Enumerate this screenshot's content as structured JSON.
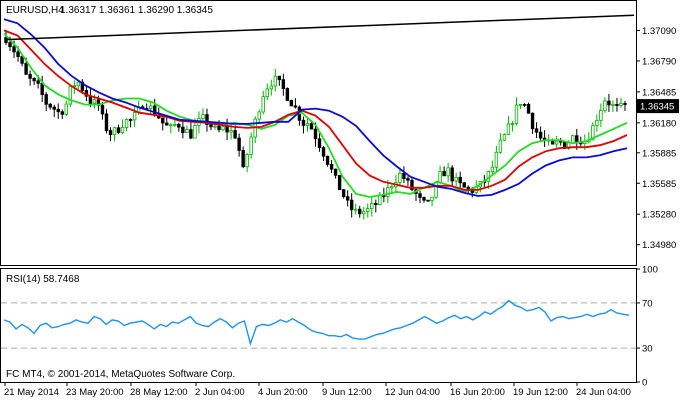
{
  "header": {
    "symbol_label": "EURUSD,H4",
    "ohlc": "1.36317 1.36361 1.36290 1.36345"
  },
  "indicator": {
    "label": "RSI(14) 58.7468"
  },
  "footer": {
    "copyright": "FC MT4, © 2001-2014, MetaQuotes Software Corp."
  },
  "colors": {
    "candle_up": "#00b400",
    "candle_down": "#000000",
    "ma_fast": "#22dd22",
    "ma_mid": "#e00000",
    "ma_slow": "#0a0ad8",
    "trendline": "#000000",
    "rsi": "#1e90ff",
    "grid_dashed": "#aaaaaa",
    "current_price_tag_bg": "#000000",
    "current_price_tag_text": "#ffffff"
  },
  "chart_data": [
    {
      "type": "candlestick",
      "title": "EURUSD,H4",
      "ylim": [
        1.3478,
        1.3738
      ],
      "yticks": [
        "1.37090",
        "1.36790",
        "1.36485",
        "1.36180",
        "1.35885",
        "1.35585",
        "1.35280",
        "1.34980"
      ],
      "ytick_values": [
        1.3709,
        1.3679,
        1.36485,
        1.3618,
        1.35885,
        1.35585,
        1.3528,
        1.3498
      ],
      "current_price_label": "1.36345",
      "current_price": 1.36345,
      "x_tick_labels": [
        "21 May 2014",
        "23 May 20:00",
        "28 May 12:00",
        "2 Jun 04:00",
        "4 Jun 20:00",
        "9 Jun 12:00",
        "12 Jun 04:00",
        "16 Jun 20:00",
        "19 Jun 12:00",
        "24 Jun 04:00"
      ],
      "close_path": [
        1.3702,
        1.3692,
        1.3681,
        1.3664,
        1.3658,
        1.3652,
        1.3638,
        1.3634,
        1.3628,
        1.3633,
        1.3655,
        1.3658,
        1.3648,
        1.3638,
        1.3636,
        1.3615,
        1.3607,
        1.3612,
        1.362,
        1.362,
        1.3628,
        1.364,
        1.3632,
        1.3626,
        1.3616,
        1.3612,
        1.3618,
        1.3612,
        1.3606,
        1.3617,
        1.3622,
        1.3616,
        1.3609,
        1.3612,
        1.361,
        1.3605,
        1.357,
        1.3598,
        1.3623,
        1.3646,
        1.3658,
        1.366,
        1.3652,
        1.3642,
        1.3632,
        1.3618,
        1.3618,
        1.3605,
        1.3592,
        1.3578,
        1.3562,
        1.355,
        1.3536,
        1.353,
        1.353,
        1.3532,
        1.3537,
        1.3544,
        1.3552,
        1.3562,
        1.3568,
        1.3558,
        1.355,
        1.354,
        1.3536,
        1.355,
        1.3567,
        1.3572,
        1.3562,
        1.3556,
        1.3552,
        1.3552,
        1.3556,
        1.3564,
        1.3576,
        1.3596,
        1.3608,
        1.3623,
        1.364,
        1.3634,
        1.3616,
        1.3604,
        1.3598,
        1.3594,
        1.36,
        1.3596,
        1.3604,
        1.3603,
        1.36,
        1.3612,
        1.3628,
        1.3642,
        1.3635,
        1.3631,
        1.36345
      ],
      "series": [
        {
          "name": "",
          "values": [
            1.3706,
            1.3692,
            1.3672,
            1.3655,
            1.3646,
            1.364,
            1.3636,
            1.3636,
            1.364,
            1.3642,
            1.3642,
            1.3638,
            1.363,
            1.3624,
            1.362,
            1.3618,
            1.3616,
            1.3618,
            1.3616,
            1.3612,
            1.3616,
            1.3625,
            1.3628,
            1.3616,
            1.3593,
            1.3565,
            1.3548,
            1.3545,
            1.3547,
            1.355,
            1.3548,
            1.3554,
            1.356,
            1.3556,
            1.355,
            1.3556,
            1.3566,
            1.3576,
            1.359,
            1.3598,
            1.3601,
            1.3601,
            1.3598,
            1.36,
            1.3606,
            1.3612,
            1.3618
          ]
        },
        {
          "name": "",
          "values": [
            1.3709,
            1.3704,
            1.369,
            1.3676,
            1.3664,
            1.3654,
            1.3646,
            1.3642,
            1.3638,
            1.3633,
            1.3628,
            1.3626,
            1.3624,
            1.362,
            1.3619,
            1.3618,
            1.3616,
            1.3614,
            1.3613,
            1.3614,
            1.3619,
            1.3626,
            1.363,
            1.3625,
            1.3614,
            1.3596,
            1.3578,
            1.3566,
            1.356,
            1.3557,
            1.3554,
            1.3554,
            1.3556,
            1.3556,
            1.3552,
            1.3552,
            1.3556,
            1.3562,
            1.3575,
            1.3584,
            1.359,
            1.3593,
            1.3594,
            1.3594,
            1.3596,
            1.36,
            1.3606
          ]
        },
        {
          "name": "",
          "values": [
            1.372,
            1.3716,
            1.3705,
            1.3692,
            1.3676,
            1.3664,
            1.3655,
            1.3648,
            1.3642,
            1.3638,
            1.3633,
            1.3629,
            1.3625,
            1.3621,
            1.362,
            1.3619,
            1.3618,
            1.3617,
            1.3617,
            1.3618,
            1.3619,
            1.3619,
            1.3631,
            1.3632,
            1.363,
            1.3624,
            1.3615,
            1.36,
            1.3586,
            1.3575,
            1.3565,
            1.356,
            1.3555,
            1.3553,
            1.3549,
            1.3546,
            1.3547,
            1.3552,
            1.3558,
            1.3568,
            1.3576,
            1.3581,
            1.3584,
            1.3584,
            1.3586,
            1.359,
            1.3593
          ]
        }
      ],
      "trendline": {
        "start": 1.37,
        "end": 1.3724
      }
    },
    {
      "type": "line",
      "title": "RSI(14) 58.7468",
      "ylim": [
        0,
        100
      ],
      "yticks": [
        "100",
        "70",
        "30",
        "0"
      ],
      "ytick_values": [
        100,
        70,
        30,
        0
      ],
      "levels": [
        70,
        30
      ],
      "values": [
        55,
        53,
        47,
        51,
        48,
        43,
        50,
        52,
        48,
        49,
        51,
        52,
        55,
        53,
        52,
        58,
        56,
        51,
        55,
        54,
        50,
        52,
        53,
        54,
        51,
        47,
        51,
        49,
        53,
        52,
        55,
        58,
        52,
        50,
        49,
        53,
        56,
        53,
        48,
        52,
        54,
        34,
        49,
        51,
        50,
        52,
        55,
        53,
        56,
        53,
        50,
        46,
        44,
        43,
        41,
        41,
        40,
        42,
        39,
        38,
        38,
        40,
        42,
        43,
        45,
        47,
        48,
        50,
        52,
        55,
        58,
        55,
        52,
        54,
        57,
        59,
        56,
        58,
        55,
        58,
        62,
        60,
        64,
        67,
        72,
        68,
        66,
        63,
        64,
        66,
        62,
        54,
        57,
        58,
        56,
        57,
        58,
        60,
        58,
        60,
        61,
        64,
        61,
        60,
        59
      ]
    }
  ]
}
